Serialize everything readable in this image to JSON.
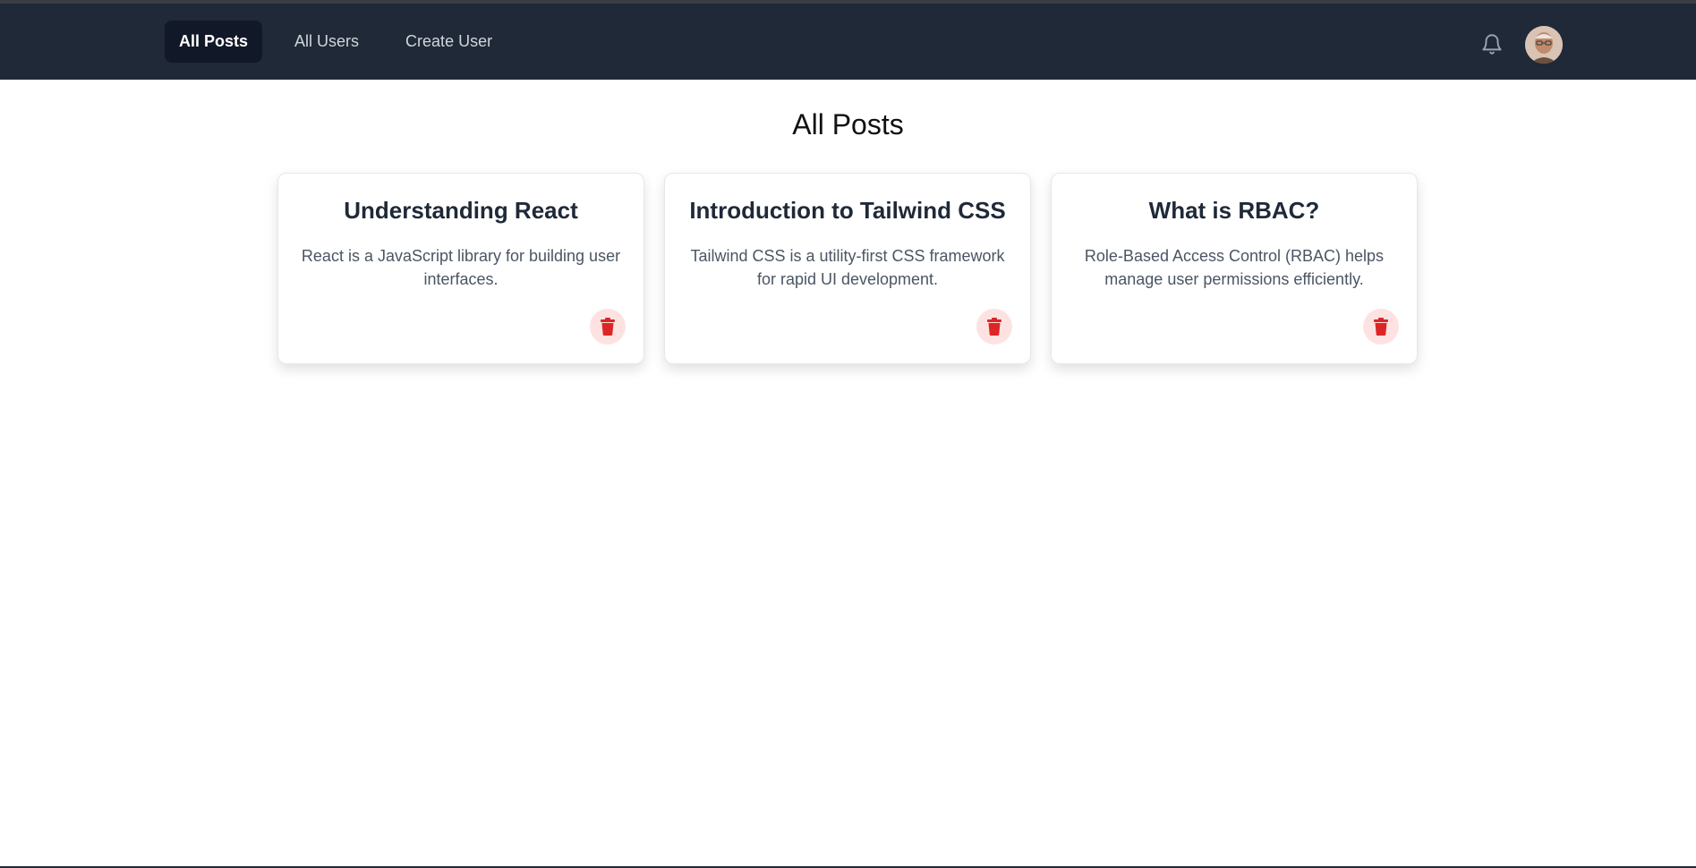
{
  "nav": {
    "links": [
      {
        "label": "All Posts",
        "active": true
      },
      {
        "label": "All Users",
        "active": false
      },
      {
        "label": "Create User",
        "active": false
      }
    ],
    "notification_icon": "bell-icon",
    "avatar_icon": "user-avatar"
  },
  "page": {
    "title": "All Posts"
  },
  "posts": [
    {
      "title": "Understanding React",
      "description": "React is a JavaScript library for building user interfaces.",
      "delete_icon": "trash-icon"
    },
    {
      "title": "Introduction to Tailwind CSS",
      "description": "Tailwind CSS is a utility-first CSS framework for rapid UI development.",
      "delete_icon": "trash-icon"
    },
    {
      "title": "What is RBAC?",
      "description": "Role-Based Access Control (RBAC) helps manage user permissions efficiently.",
      "delete_icon": "trash-icon"
    }
  ],
  "colors": {
    "navbar_bg": "#1f2937",
    "active_link_bg": "#111827",
    "delete_accent": "#dc2626",
    "delete_bg": "#fee2e2"
  }
}
